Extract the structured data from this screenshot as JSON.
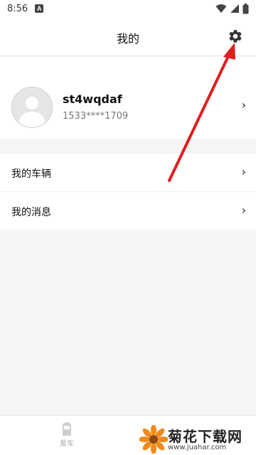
{
  "status_bar": {
    "time": "8:56",
    "badge": "A"
  },
  "header": {
    "title": "我的"
  },
  "profile": {
    "username": "st4wqdaf",
    "phone": "1533****1709"
  },
  "menu": {
    "items": [
      {
        "label": "我的车辆"
      },
      {
        "label": "我的消息"
      }
    ]
  },
  "bottom_nav": {
    "tabs": [
      {
        "label": "爱车",
        "icon": "car-icon"
      }
    ]
  },
  "watermark": {
    "title": "菊花下载网",
    "url": "www.juahar.com"
  },
  "colors": {
    "arrow": "#e01f1f"
  },
  "icons": [
    "wifi-icon",
    "signal-icon",
    "battery-icon",
    "gear-icon",
    "avatar-icon",
    "chevron-right-icon",
    "flower-icon"
  ]
}
